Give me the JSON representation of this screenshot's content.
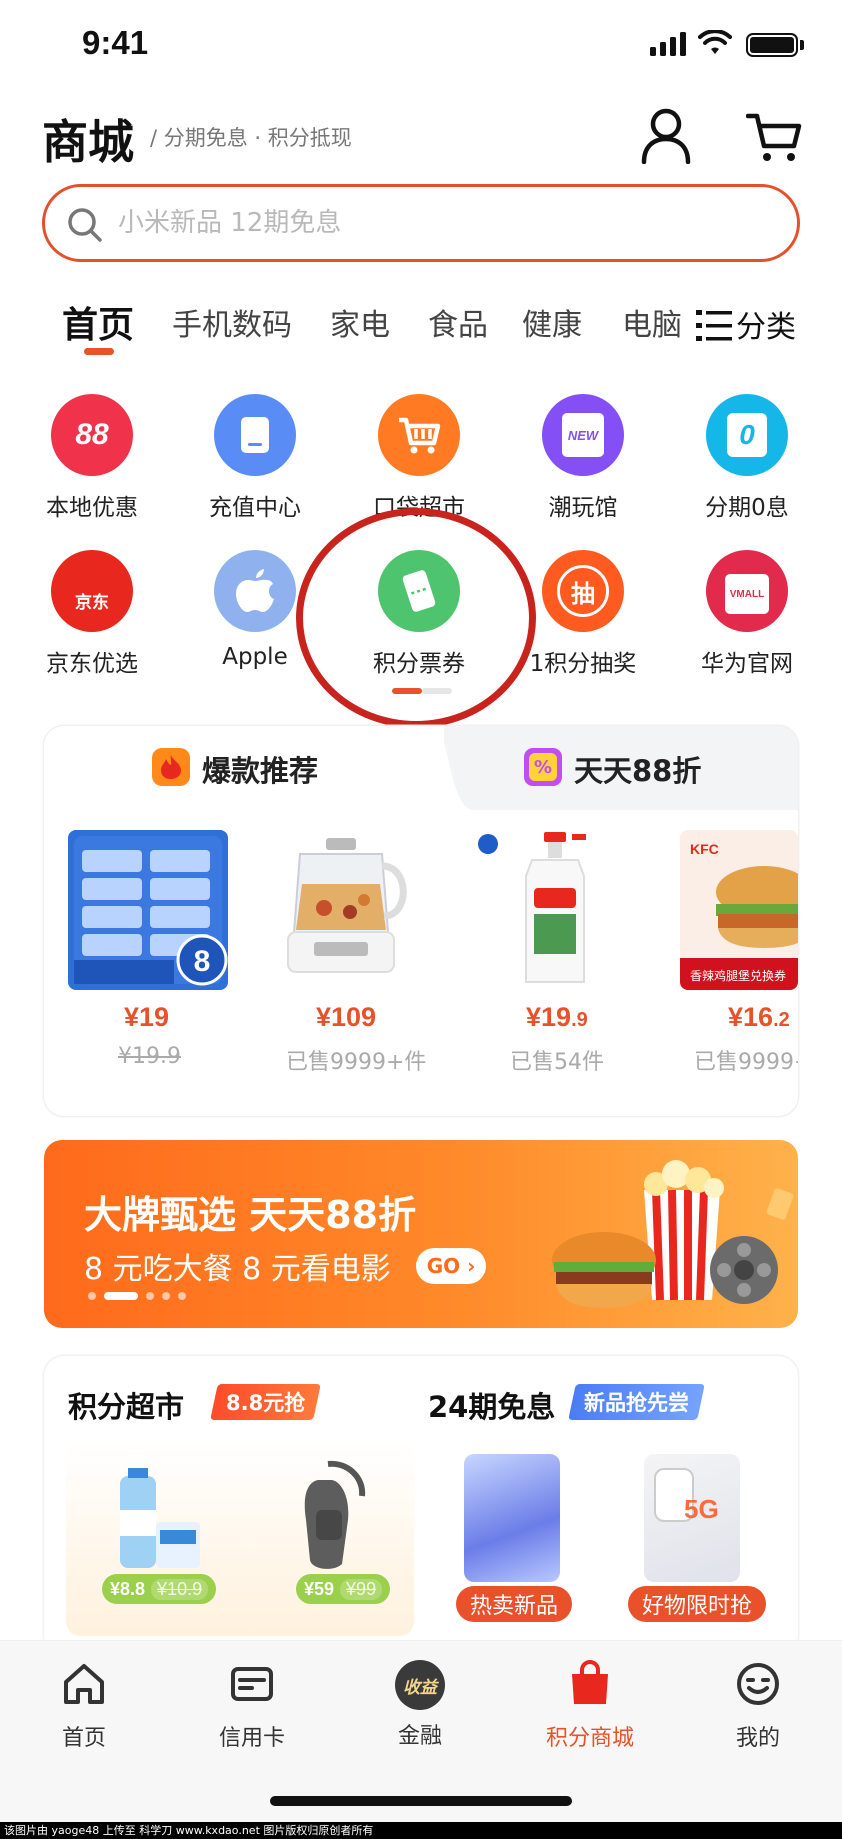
{
  "status_bar": {
    "time": "9:41"
  },
  "header": {
    "title": "商城",
    "subtitle": "/ 分期免息 · 积分抵现"
  },
  "search": {
    "placeholder": "小米新品 12期免息"
  },
  "tabs": [
    {
      "label": "首页",
      "active": true
    },
    {
      "label": "手机数码"
    },
    {
      "label": "家电"
    },
    {
      "label": "食品"
    },
    {
      "label": "健康"
    },
    {
      "label": "电脑"
    }
  ],
  "category_label": "分类",
  "quick_icons": [
    {
      "label": "本地优惠",
      "icon": "88-percent-icon",
      "glyph": "88",
      "color": "#f0324a"
    },
    {
      "label": "充值中心",
      "icon": "phone-recharge-icon",
      "glyph": "",
      "color": "#5a8cf5"
    },
    {
      "label": "口袋超市",
      "icon": "shopping-cart-icon",
      "glyph": "",
      "color": "#ff7a22"
    },
    {
      "label": "潮玩馆",
      "icon": "new-tag-icon",
      "glyph": "NEW",
      "color": "#8450f5"
    },
    {
      "label": "分期0息",
      "icon": "bag-zero-icon",
      "glyph": "0",
      "color": "#14b7e8"
    },
    {
      "label": "京东优选",
      "icon": "jd-dog-icon",
      "glyph": "京东",
      "color": "#e8281e"
    },
    {
      "label": "Apple",
      "icon": "apple-logo-icon",
      "glyph": "",
      "color": "#8fb2ef"
    },
    {
      "label": "积分票券",
      "icon": "ticket-icon",
      "glyph": "",
      "color": "#4ec46e"
    },
    {
      "label": "1积分抽奖",
      "icon": "lottery-icon",
      "glyph": "抽",
      "color": "#ff5a1f"
    },
    {
      "label": "华为官网",
      "icon": "vmall-bag-icon",
      "glyph": "VMALL",
      "color": "#e22a4d"
    }
  ],
  "hot_section": {
    "tab_left": "爆款推荐",
    "tab_right": "天天88折",
    "right_badge": "%",
    "products": [
      {
        "price_main": "¥19",
        "price_dec": "",
        "sub": "¥19.9",
        "sub_strike": true,
        "image": "tissue-box-image"
      },
      {
        "price_main": "¥109",
        "price_dec": "",
        "sub": "已售9999+件",
        "sub_strike": false,
        "image": "health-kettle-image"
      },
      {
        "price_main": "¥19",
        "price_dec": ".9",
        "sub": "已售54件",
        "sub_strike": false,
        "image": "detergent-bottle-image"
      },
      {
        "price_main": "¥16",
        "price_dec": ".2",
        "sub": "已售9999+",
        "sub_strike": false,
        "image": "kfc-burger-image"
      }
    ],
    "product_labels": {
      "tissue_badge": "8",
      "kfc_brand": "KFC",
      "kfc_caption": "香辣鸡腿堡兑换券"
    }
  },
  "banner": {
    "title": "大牌甄选 天天88折",
    "subtitle": "8 元吃大餐  8 元看电影",
    "go": "GO ›"
  },
  "deals": {
    "left_title": "积分超市",
    "left_tag": "8.8元抢",
    "right_title": "24期免息",
    "right_tag": "新品抢先尝",
    "left_items": [
      {
        "price": "¥8.8",
        "old": "¥10.9"
      },
      {
        "price": "¥59",
        "old": "¥99"
      }
    ],
    "right_items": [
      {
        "label": "热卖新品"
      },
      {
        "label": "好物限时抢"
      }
    ],
    "phone_badge": "5G"
  },
  "bottom_nav": [
    {
      "label": "首页",
      "icon": "home-icon",
      "active": false
    },
    {
      "label": "信用卡",
      "icon": "credit-card-icon",
      "active": false
    },
    {
      "label": "金融",
      "icon": "finance-badge-icon",
      "active": false,
      "badge": "收益"
    },
    {
      "label": "积分商城",
      "icon": "shopping-bag-icon",
      "active": true
    },
    {
      "label": "我的",
      "icon": "smiley-icon",
      "active": false
    }
  ],
  "watermark": "该图片由 yaoge48 上传至 科学刀 www.kxdao.net 图片版权归原创者所有",
  "colors": {
    "accent": "#e8512a",
    "highlight_ring": "#c8241d"
  }
}
